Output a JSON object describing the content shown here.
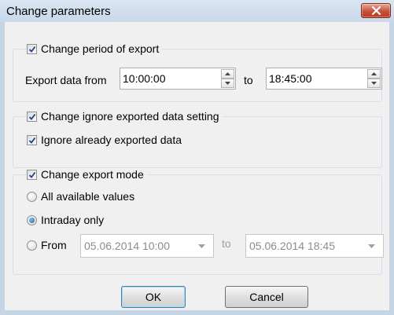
{
  "window": {
    "title": "Change parameters"
  },
  "period_group": {
    "checkbox_label": "Change period of export",
    "checked": true,
    "from_label": "Export data from",
    "from_value": "10:00:00",
    "to_label": "to",
    "to_value": "18:45:00"
  },
  "ignore_group": {
    "checkbox_label": "Change ignore exported data setting",
    "checked": true,
    "ignore_label": "Ignore already exported data",
    "ignore_checked": true
  },
  "mode_group": {
    "checkbox_label": "Change export mode",
    "checked": true,
    "options": [
      {
        "label": "All available values",
        "selected": false
      },
      {
        "label": "Intraday only",
        "selected": true
      },
      {
        "label": "From",
        "selected": false
      }
    ],
    "from_datetime": "05.06.2014 10:00",
    "to_label": "to",
    "to_datetime": "05.06.2014 18:45"
  },
  "buttons": {
    "ok": "OK",
    "cancel": "Cancel"
  },
  "colors": {
    "accent": "#1c5fb3",
    "close": "#c7503a",
    "frame": "#c6d5e6"
  }
}
